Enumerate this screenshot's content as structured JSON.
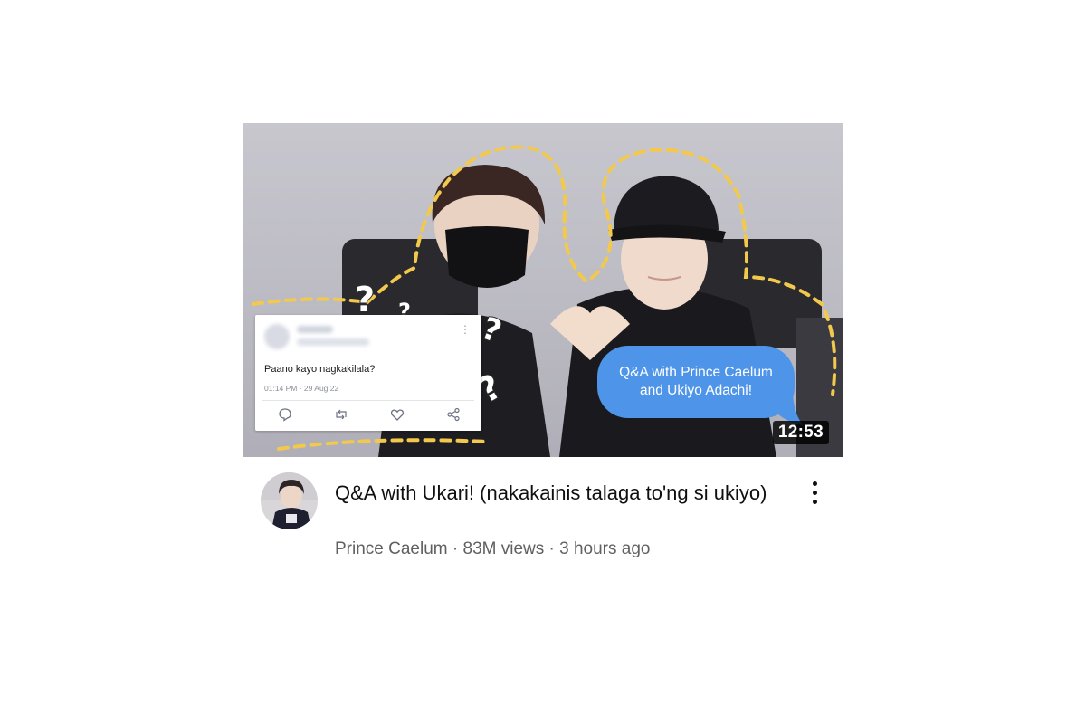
{
  "thumbnail": {
    "tweet": {
      "text": "Paano kayo nagkakilala?",
      "timestamp": "01:14 PM · 29 Aug 22",
      "more_glyph": "⋮",
      "actions": [
        "reply-icon",
        "retweet-icon",
        "like-icon",
        "share-icon"
      ]
    },
    "question_marks": [
      "?",
      "?",
      "?",
      "?"
    ],
    "caption": "Q&A with Prince Caelum and Ukiyo Adachi!",
    "duration": "12:53",
    "colors": {
      "dashed_outline": "#f2c94c",
      "caption_bubble": "#4e94e8",
      "tweet_text": "#1a1a1a"
    }
  },
  "video": {
    "title": "Q&A with Ukari! (nakakainis talaga to'ng si ukiyo)",
    "channel": "Prince Caelum",
    "views": "83M views",
    "age": "3 hours ago",
    "separator": " · "
  }
}
